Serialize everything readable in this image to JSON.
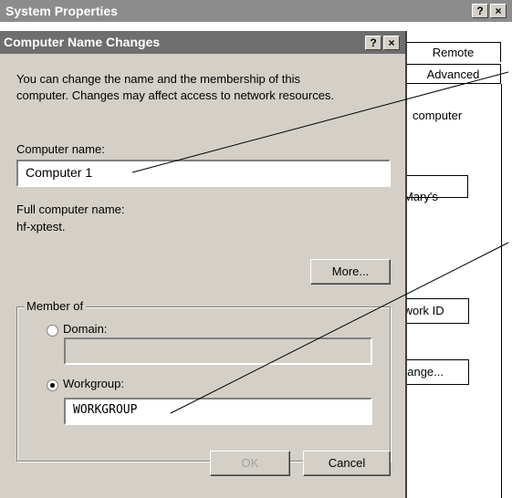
{
  "outer_window": {
    "title": "System Properties",
    "help_btn": "?",
    "close_btn": "×",
    "tabs": [
      "Remote",
      "Advanced"
    ],
    "side_texts": [
      "computer",
      "Mary's"
    ],
    "network_id_btn": "twork ID",
    "change_btn": "hange..."
  },
  "dialog": {
    "title": "Computer Name Changes",
    "help_btn": "?",
    "close_btn": "×",
    "description_line1": "You can change the name and the membership of this",
    "description_line2": "computer. Changes may affect access to network resources.",
    "computer_name_label": "Computer name:",
    "computer_name_value": "Computer 1",
    "full_name_label": "Full computer name:",
    "full_name_value": "hf-xptest.",
    "more_btn": "More...",
    "member_of_label": "Member of",
    "domain_label": "Domain:",
    "domain_value": "",
    "workgroup_label": "Workgroup:",
    "workgroup_value": "WORKGROUP",
    "selected_membership": "workgroup",
    "ok_btn": "OK",
    "cancel_btn": "Cancel"
  }
}
